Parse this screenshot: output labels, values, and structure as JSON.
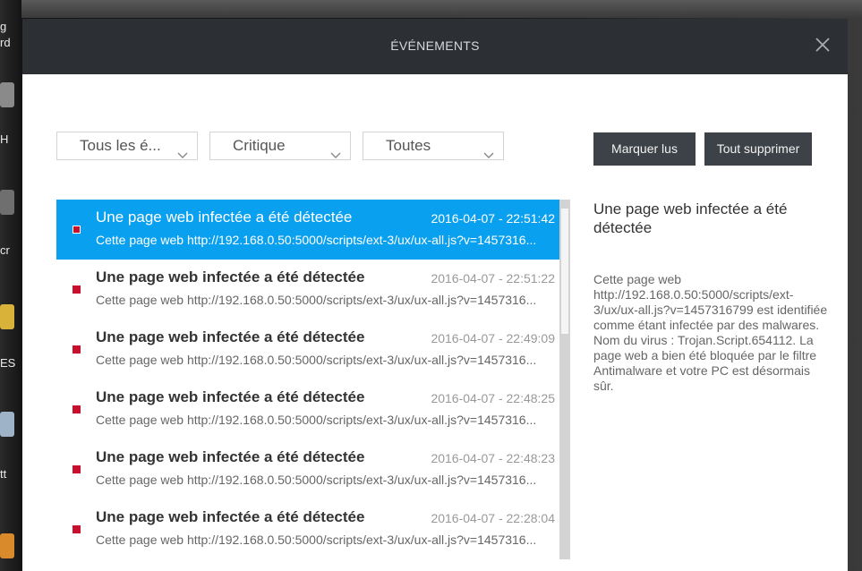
{
  "desktop": {
    "fragments": [
      "g",
      "rd",
      "H",
      "cr",
      "ES",
      "tt"
    ]
  },
  "dialog": {
    "title": "ÉVÉNEMENTS",
    "close_icon": "close-icon"
  },
  "filters": {
    "type": "Tous les é...",
    "severity": "Critique",
    "status": "Toutes"
  },
  "actions": {
    "mark_read": "Marquer lus",
    "delete_all": "Tout supprimer"
  },
  "events": [
    {
      "title": "Une page web infectée a été détectée",
      "date": "2016-04-07 - 22:51:42",
      "desc": "Cette page web http://192.168.0.50:5000/scripts/ext-3/ux/ux-all.js?v=1457316...",
      "selected": true
    },
    {
      "title": "Une page web infectée a été détectée",
      "date": "2016-04-07 - 22:51:22",
      "desc": "Cette page web http://192.168.0.50:5000/scripts/ext-3/ux/ux-all.js?v=1457316...",
      "selected": false
    },
    {
      "title": "Une page web infectée a été détectée",
      "date": "2016-04-07 - 22:49:09",
      "desc": "Cette page web http://192.168.0.50:5000/scripts/ext-3/ux/ux-all.js?v=1457316...",
      "selected": false
    },
    {
      "title": "Une page web infectée a été détectée",
      "date": "2016-04-07 - 22:48:25",
      "desc": "Cette page web http://192.168.0.50:5000/scripts/ext-3/ux/ux-all.js?v=1457316...",
      "selected": false
    },
    {
      "title": "Une page web infectée a été détectée",
      "date": "2016-04-07 - 22:48:23",
      "desc": "Cette page web http://192.168.0.50:5000/scripts/ext-3/ux/ux-all.js?v=1457316...",
      "selected": false
    },
    {
      "title": "Une page web infectée a été détectée",
      "date": "2016-04-07 - 22:28:04",
      "desc": "Cette page web http://192.168.0.50:5000/scripts/ext-3/ux/ux-all.js?v=1457316...",
      "selected": false
    }
  ],
  "detail": {
    "title": "Une page web infectée a été détectée",
    "body": "Cette page web http://192.168.0.50:5000/scripts/ext-3/ux/ux-all.js?v=1457316799 est identifiée comme étant infectée par des malwares. Nom du virus : Trojan.Script.654112. La page web a bien été bloquée par le filtre Antimalware et votre PC est désormais sûr."
  },
  "colors": {
    "titlebar": "#2c2f34",
    "selection": "#0aa0f0",
    "severity_mark": "#c8102e",
    "button": "#3d4248"
  }
}
